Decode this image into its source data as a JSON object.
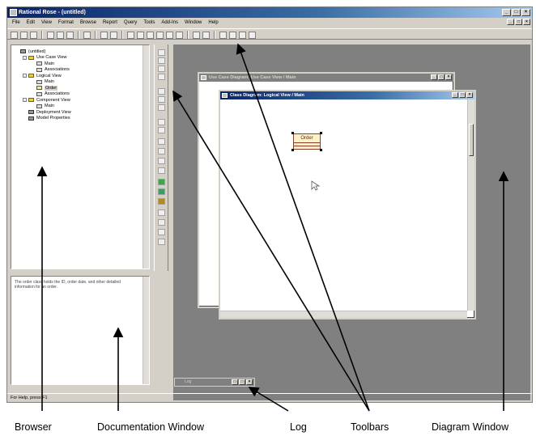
{
  "app": {
    "title": "Rational Rose - (untitled)",
    "menu": [
      "File",
      "Edit",
      "View",
      "Format",
      "Browse",
      "Report",
      "Query",
      "Tools",
      "Add-Ins",
      "Window",
      "Help"
    ],
    "status": "For Help, press F1"
  },
  "browser": {
    "items": [
      {
        "label": "(untitled)",
        "level": 0,
        "icon": "model-icon",
        "toggle": ""
      },
      {
        "label": "Use Case View",
        "level": 1,
        "icon": "folder-icon",
        "toggle": "-"
      },
      {
        "label": "Main",
        "level": 2,
        "icon": "diagram-icon",
        "toggle": ""
      },
      {
        "label": "Associations",
        "level": 2,
        "icon": "diagram-icon",
        "toggle": ""
      },
      {
        "label": "Logical View",
        "level": 1,
        "icon": "folder-icon",
        "toggle": "-"
      },
      {
        "label": "Main",
        "level": 2,
        "icon": "diagram-icon",
        "toggle": ""
      },
      {
        "label": "Order",
        "level": 2,
        "icon": "class-icon",
        "toggle": "",
        "selected": true
      },
      {
        "label": "Associations",
        "level": 2,
        "icon": "diagram-icon",
        "toggle": ""
      },
      {
        "label": "Component View",
        "level": 1,
        "icon": "folder-icon",
        "toggle": "-"
      },
      {
        "label": "Main",
        "level": 2,
        "icon": "diagram-icon",
        "toggle": ""
      },
      {
        "label": "Deployment View",
        "level": 1,
        "icon": "model-icon",
        "toggle": ""
      },
      {
        "label": "Model Properties",
        "level": 1,
        "icon": "model-icon",
        "toggle": ""
      }
    ]
  },
  "documentation": {
    "text": "The order class holds the ID, order date, and other detailed information for an order."
  },
  "windows": {
    "back_title": "Use Case Diagram: Use Case View / Main",
    "front_title": "Class Diagram: Logical View / Main",
    "class_name": "Order",
    "log_title": "Log"
  },
  "captions": {
    "browser": "Browser",
    "documentation": "Documentation Window",
    "log": "Log",
    "toolbars": "Toolbars",
    "diagram": "Diagram Window"
  }
}
